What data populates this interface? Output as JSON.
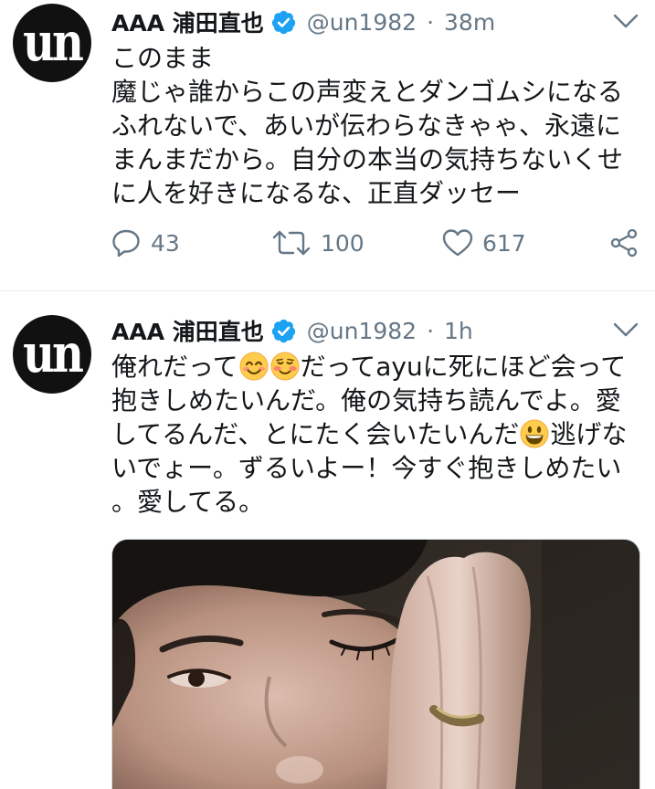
{
  "tweets": [
    {
      "author": {
        "name": "AAA 浦田直也",
        "handle": "@un1982",
        "avatar_logo": "un",
        "verified": true
      },
      "separator": "·",
      "time": "38m",
      "body_lines": [
        [
          {
            "text": "このまま"
          }
        ],
        [
          {
            "text": "魔じゃ誰からこの声変えとダンゴムシになる"
          }
        ],
        [
          {
            "text": "ふれないで、あいが伝わらなきゃゃ、永遠に"
          }
        ],
        [
          {
            "text": "まんまだから。自分の本当の気持ちないくせ"
          }
        ],
        [
          {
            "text": "に人を好きになるな、正直ダッセー"
          }
        ]
      ],
      "stats": {
        "replies": "43",
        "retweets": "100",
        "likes": "617"
      }
    },
    {
      "author": {
        "name": "AAA 浦田直也",
        "handle": "@un1982",
        "avatar_logo": "un",
        "verified": true
      },
      "separator": "·",
      "time": "1h",
      "body_lines": [
        [
          {
            "text": "俺れだって"
          },
          {
            "emoji": "smiling-face-with-smiling-eyes"
          },
          {
            "emoji": "smiling-face"
          },
          {
            "text": "だってayuに死にほど会って"
          }
        ],
        [
          {
            "text": "抱きしめたいんだ。俺の気持ち読んでよ。愛"
          }
        ],
        [
          {
            "text": "してるんだ、とにたく会いたいんだ"
          },
          {
            "emoji": "grinning-face-with-big-eyes"
          },
          {
            "text": "逃げな"
          }
        ],
        [
          {
            "text": "いでょー。ずるいよー！今すぐ抱きしめたい"
          }
        ],
        [
          {
            "text": "。愛してる。"
          }
        ]
      ],
      "has_photo": true
    }
  ],
  "icons": {
    "verified": "verified-badge-icon",
    "menu": "chevron-down-icon",
    "reply": "reply-icon",
    "retweet": "retweet-icon",
    "like": "heart-icon",
    "share": "share-icon"
  },
  "colors": {
    "text": "#14171a",
    "secondary": "#657786",
    "verified": "#1da1f2",
    "divider": "#e6ecf0",
    "avatar_bg": "#111111"
  }
}
